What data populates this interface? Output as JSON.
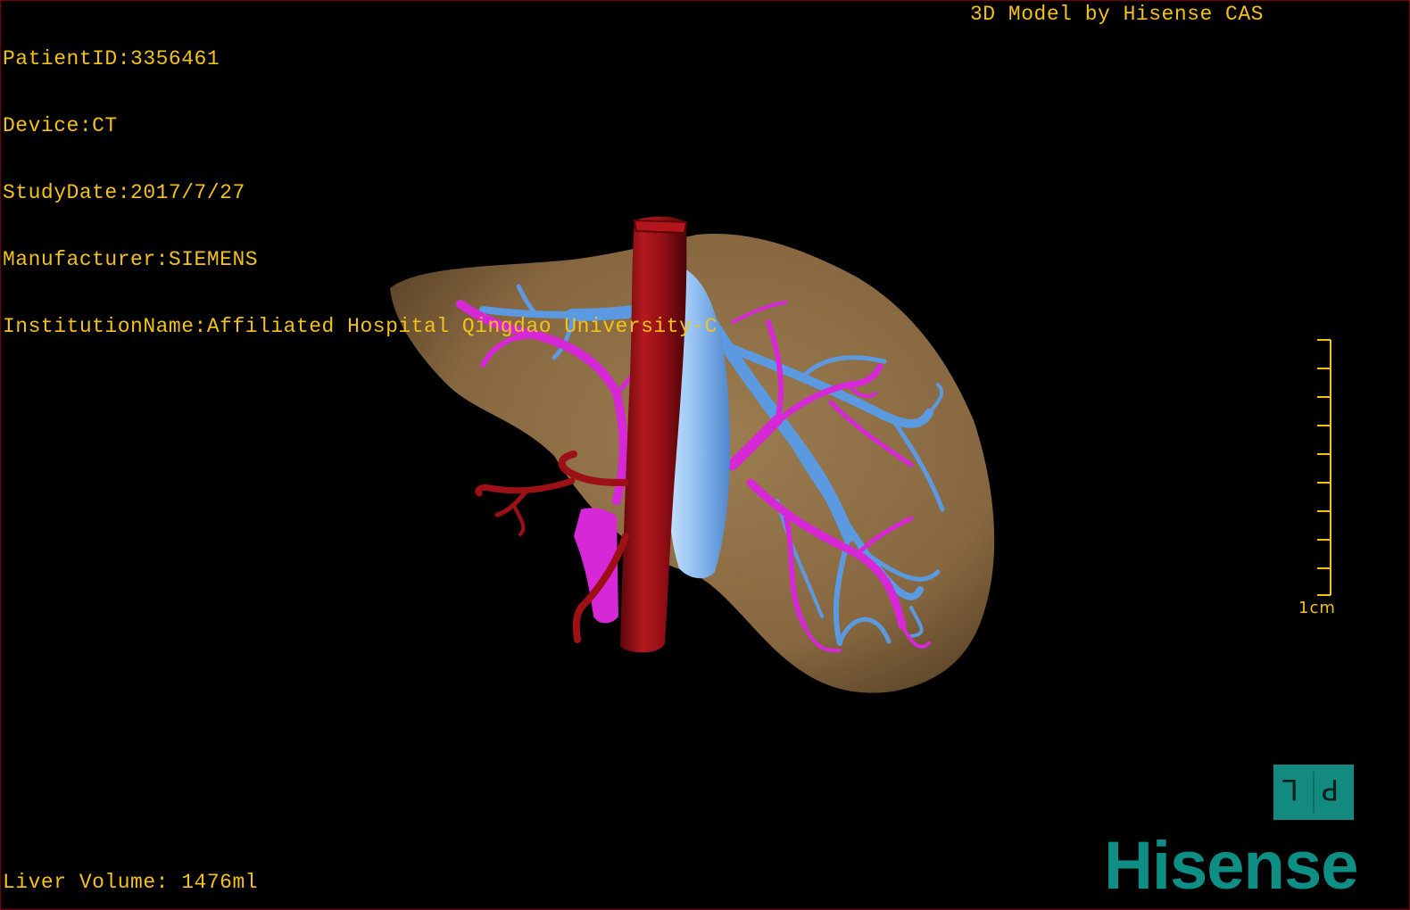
{
  "dicom_info": {
    "patient_id": "PatientID:3356461",
    "device": "Device:CT",
    "study_date": "StudyDate:2017/7/27",
    "manufacturer": "Manufacturer:SIEMENS",
    "institution": "InstitutionName:Affiliated Hospital Qingdao University-C"
  },
  "model_credit": "3D Model by Hisense CAS",
  "liver_volume": "Liver Volume: 1476ml",
  "scale_bar": {
    "label": "1cm",
    "color": "#f2c21a"
  },
  "orientation_cube": {
    "left_glyph": "L",
    "right_glyph": "P",
    "color": "#128a80"
  },
  "brand": "Hisense",
  "colors": {
    "liver": "#8a6c45",
    "aorta": "#9c1016",
    "portal_vein": "#d628d6",
    "hepatic_vein": "#5b9ae0",
    "vena_cava": "#8fc0f2",
    "hud_text": "#f2c21a",
    "brand": "#0d8f86"
  }
}
